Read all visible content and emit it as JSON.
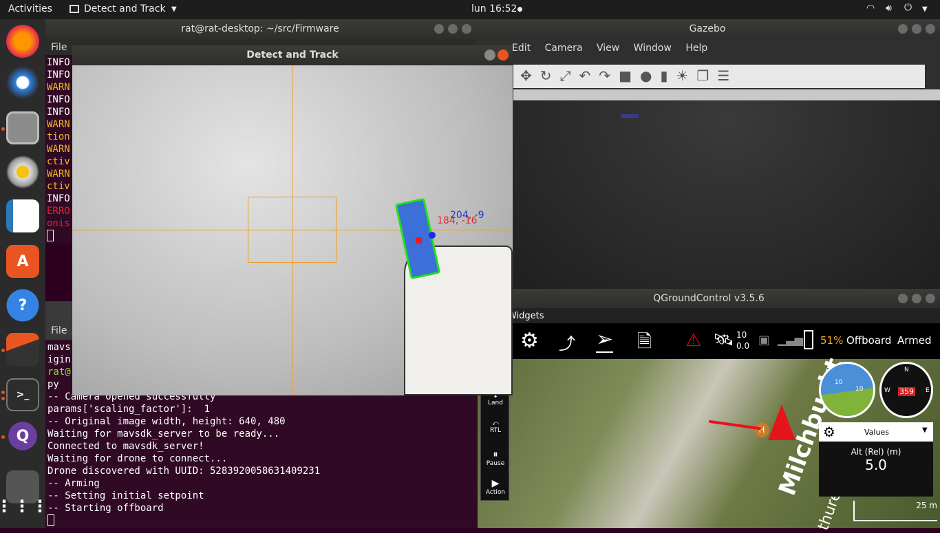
{
  "topbar": {
    "activities": "Activities",
    "app": "Detect and Track",
    "clock": "lun 16:52"
  },
  "terminal1": {
    "title": "rat@rat-desktop: ~/src/Firmware",
    "menu": "File",
    "lines": [
      {
        "t": "INFO",
        "c": "#fff"
      },
      {
        "t": "INFO",
        "c": "#fff"
      },
      {
        "t": "WARN",
        "c": "#f3b91f"
      },
      {
        "t": "INFO",
        "c": "#fff"
      },
      {
        "t": "INFO",
        "c": "#fff"
      },
      {
        "t": "WARN",
        "c": "#f3b91f"
      },
      {
        "t": "tion",
        "c": "#f3b91f"
      },
      {
        "t": "WARN",
        "c": "#f3b91f"
      },
      {
        "t": "ctiv",
        "c": "#f3b91f"
      },
      {
        "t": "WARN",
        "c": "#f3b91f"
      },
      {
        "t": "ctiv",
        "c": "#f3b91f"
      },
      {
        "t": "INFO",
        "c": "#fff"
      },
      {
        "t": "ERRO",
        "c": "#e8222c"
      },
      {
        "t": "onis",
        "c": "#e8222c"
      }
    ]
  },
  "terminal2": {
    "menu": "File",
    "partial": [
      "mavs",
      "igin",
      "rat@",
      "py"
    ],
    "lines": [
      "-- Camera opened successfully",
      "params['scaling_factor']:  1",
      "-- Original image width, height: 640, 480",
      "Waiting for mavsdk_server to be ready...",
      "Connected to mavsdk_server!",
      "Waiting for drone to connect...",
      "Drone discovered with UUID: 5283920058631409231",
      "-- Arming",
      "-- Setting initial setpoint",
      "-- Starting offboard"
    ]
  },
  "detect": {
    "title": "Detect and Track",
    "label_blue": "204, -9",
    "label_red": "184, -16"
  },
  "gazebo": {
    "title": "Gazebo",
    "menu": [
      "Edit",
      "Camera",
      "View",
      "Window",
      "Help"
    ]
  },
  "qgc": {
    "title": "QGroundControl v3.5.6",
    "widgets": "Widgets",
    "sats": "10",
    "hdop": "0.0",
    "battery": "51%",
    "mode": "Offboard",
    "armed": "Armed",
    "actions": [
      "Land",
      "RTL",
      "Pause",
      "Action"
    ],
    "values_label": "Values",
    "alt_label": "Alt (Rel) (m)",
    "alt_value": "5.0",
    "heading": "359",
    "scale": "25 m",
    "home": "H",
    "map_text": "Milchbuckt",
    "map_text2": "thurers",
    "compass": {
      "n": "N",
      "e": "E",
      "w": "W"
    },
    "att_ticks": [
      "10",
      "10"
    ]
  },
  "colors": {
    "orange": "#e95420",
    "qgc_green": "#67c31c",
    "battery_orange": "#f5a623"
  }
}
